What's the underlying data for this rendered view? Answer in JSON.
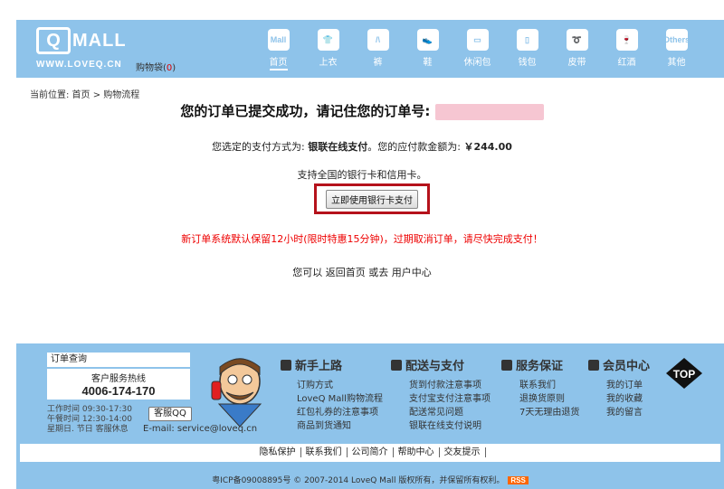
{
  "header": {
    "logo_mark": "Q",
    "logo_text": "MALL",
    "logo_url": "WWW.LOVEQ.CN",
    "cart_label": "购物袋(",
    "cart_count": "0",
    "cart_close": ")",
    "nav": [
      {
        "label": "首页",
        "icon": "mall-icon",
        "glyph": "Mall"
      },
      {
        "label": "上衣",
        "icon": "shirt-icon",
        "glyph": "👕"
      },
      {
        "label": "裤",
        "icon": "pants-icon",
        "glyph": "/\\"
      },
      {
        "label": "鞋",
        "icon": "shoe-icon",
        "glyph": "👟"
      },
      {
        "label": "休闲包",
        "icon": "bag-icon",
        "glyph": "▭"
      },
      {
        "label": "钱包",
        "icon": "wallet-icon",
        "glyph": "▯"
      },
      {
        "label": "皮带",
        "icon": "belt-icon",
        "glyph": "➰"
      },
      {
        "label": "红酒",
        "icon": "wine-icon",
        "glyph": "🍷"
      },
      {
        "label": "其他",
        "icon": "others-icon",
        "glyph": "Others"
      }
    ]
  },
  "breadcrumb": "当前位置: 首页 > 购物流程",
  "main": {
    "title": "您的订单已提交成功，请记住您的订单号:",
    "pay_prefix": "您选定的支付方式为: ",
    "pay_method": "银联在线支付",
    "pay_mid": "。您的应付款金额为: ",
    "amount": "￥244.00",
    "support": "支持全国的银行卡和信用卡。",
    "pay_button": "立即使用银行卡支付",
    "warning": "新订单系统默认保留12小时(限时特惠15分钟)，过期取消订单，请尽快完成支付！",
    "links_prefix": "您可以 ",
    "link_home": "返回首页",
    "links_mid": " 或去 ",
    "link_user": "用户中心"
  },
  "footer": {
    "order_query": "订单查询",
    "hotline_title": "客户服务热线",
    "hotline_number": "4006-174-170",
    "hours": [
      "工作时间  09:30-17:30",
      "午餐时间  12:30-14:00",
      "星期日. 节日  客服休息"
    ],
    "qq_button": "客服QQ",
    "email": "E-mail: service@loveq.cn",
    "columns": [
      {
        "title": "新手上路",
        "icon": "question-icon",
        "items": [
          "订购方式",
          "LoveQ Mall购物流程",
          "红包礼券的注意事项",
          "商品到货通知"
        ]
      },
      {
        "title": "配送与支付",
        "icon": "delivery-icon",
        "items": [
          "货到付款注意事项",
          "支付宝支付注意事项",
          "配送常见问题",
          "银联在线支付说明"
        ]
      },
      {
        "title": "服务保证",
        "icon": "check-icon",
        "items": [
          "联系我们",
          "退换货原则",
          "7天无理由退货"
        ]
      },
      {
        "title": "会员中心",
        "icon": "members-icon",
        "items": [
          "我的订单",
          "我的收藏",
          "我的留言"
        ]
      }
    ],
    "top_label": "TOP",
    "bar_links": [
      "隐私保护",
      "联系我们",
      "公司简介",
      "帮助中心",
      "交友提示"
    ],
    "copyright": "粤ICP备09008895号 © 2007-2014 LoveQ Mall 版权所有，并保留所有权利。",
    "rss": "RSS"
  }
}
